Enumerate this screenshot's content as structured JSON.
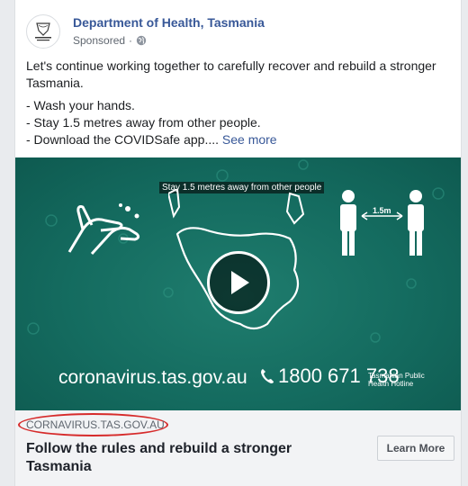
{
  "post": {
    "page_name": "Department of Health, Tasmania",
    "sponsored": "Sponsored",
    "separator": "·",
    "avatar_text": "Tasmanian Government",
    "text_line1": "Let's continue working together to carefully recover and rebuild a stronger Tasmania.",
    "bullet1": "- Wash your hands.",
    "bullet2": "- Stay 1.5 metres away from other people.",
    "bullet3": "- Download the COVIDSafe app....",
    "see_more": "See more"
  },
  "video": {
    "caption": "Stay 1.5 metres away from other people",
    "distance_label": "1.5m",
    "url": "coronavirus.tas.gov.au",
    "phone": "1800 671 738",
    "hotline": "Tasmanian Public Health Hotline"
  },
  "link": {
    "domain": "CORNAVIRUS.TAS.GOV.AU",
    "title": "Follow the rules and rebuild a stronger Tasmania",
    "cta": "Learn More"
  },
  "colors": {
    "page_name": "#385898",
    "video_bg": "#146b5f",
    "highlight": "#d62b2b"
  }
}
